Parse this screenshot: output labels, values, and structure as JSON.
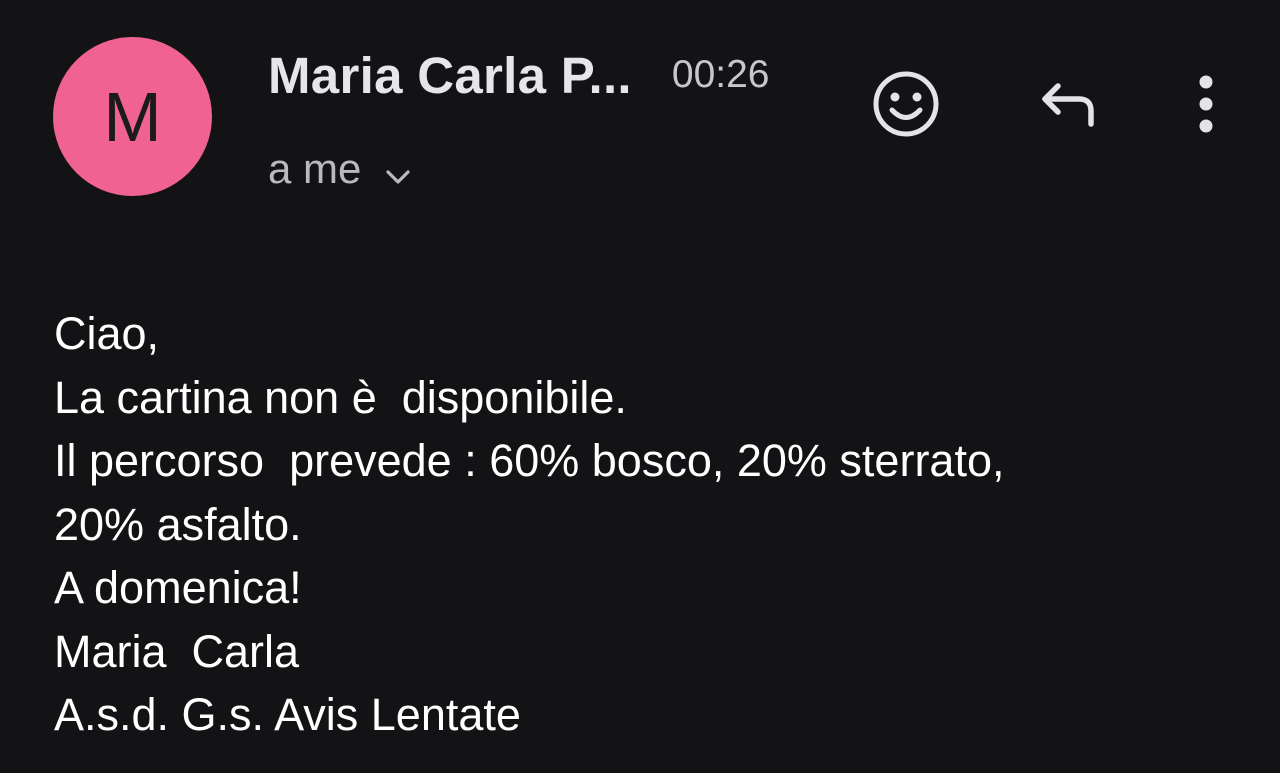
{
  "colors": {
    "background": "#131316",
    "avatar": "#f06292"
  },
  "header": {
    "avatar_letter": "M",
    "sender_name": "Maria Carla P...",
    "time": "00:26",
    "recipient": "a me",
    "recipient_toggle_icon": "chevron-down-icon",
    "emoji_icon": "emoji-smile-icon",
    "reply_icon": "reply-icon",
    "more_icon": "more-vert-icon"
  },
  "message": {
    "lines": [
      "Ciao,",
      "La cartina non è  disponibile.",
      "Il percorso  prevede : 60% bosco, 20% sterrato,",
      "20% asfalto.",
      "A domenica!",
      "Maria  Carla",
      "A.s.d. G.s. Avis Lentate"
    ]
  }
}
